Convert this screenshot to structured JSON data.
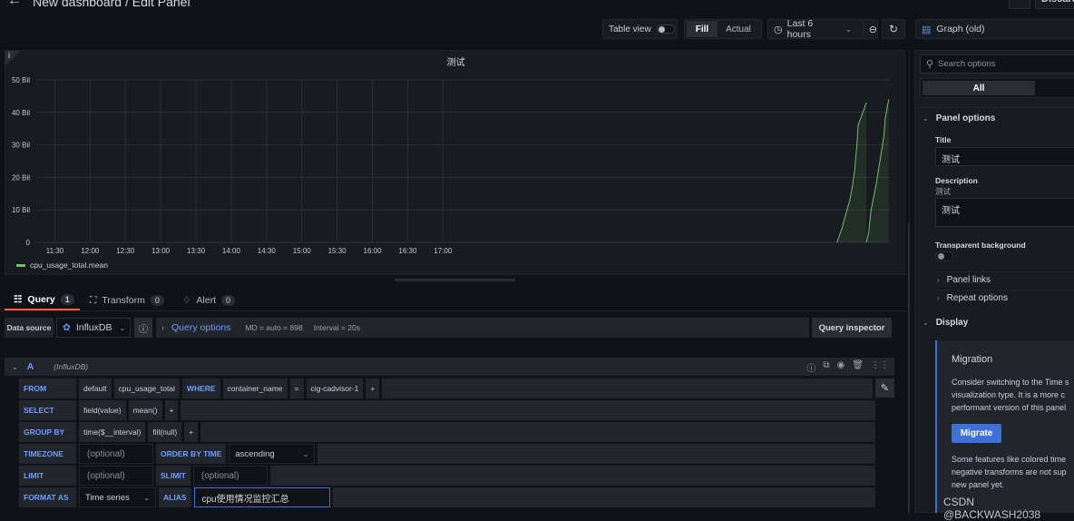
{
  "header": {
    "breadcrumb": "New dashboard / Edit Panel",
    "discard_label": "Discard"
  },
  "toolbar": {
    "table_view_label": "Table view",
    "table_view_on": false,
    "fill_label": "Fill",
    "actual_label": "Actual",
    "active_mode": "Fill",
    "time_range": "Last 6 hours",
    "visualization": "Graph (old)"
  },
  "panel": {
    "title": "测试",
    "info_icon": "i",
    "legend": "cpu_usage_total.mean"
  },
  "chart_data": {
    "type": "area",
    "title": "测试",
    "xlabel": "",
    "ylabel": "",
    "x_ticks": [
      "11:30",
      "12:00",
      "12:30",
      "13:00",
      "13:30",
      "14:00",
      "14:30",
      "15:00",
      "15:30",
      "16:00",
      "16:30",
      "17:00"
    ],
    "y_ticks": [
      "0",
      "10 Bil",
      "20 Bil",
      "30 Bil",
      "40 Bil",
      "50 Bil"
    ],
    "ylim": [
      0,
      50
    ],
    "y_unit": "Bil",
    "grid": true,
    "legend_position": "bottom-left",
    "x_range_minutes": [
      -15,
      710
    ],
    "series": [
      {
        "name": "cpu_usage_total.mean",
        "color": "#73bf69",
        "segments": [
          [
            [
              665,
              0
            ],
            [
              669,
              4
            ],
            [
              672,
              8
            ],
            [
              676,
              13
            ],
            [
              678,
              17
            ],
            [
              680,
              22
            ],
            [
              682,
              30
            ],
            [
              683,
              36
            ],
            [
              686,
              39
            ],
            [
              690,
              43
            ]
          ],
          [
            [
              690,
              0
            ],
            [
              692,
              3
            ],
            [
              694,
              10
            ],
            [
              698,
              17
            ],
            [
              702,
              26
            ],
            [
              705,
              33
            ],
            [
              706,
              38
            ],
            [
              709,
              44
            ]
          ]
        ]
      }
    ]
  },
  "query_tabs": [
    {
      "label": "Query",
      "count": "1",
      "active": true
    },
    {
      "label": "Transform",
      "count": "0",
      "active": false
    },
    {
      "label": "Alert",
      "count": "0",
      "active": false
    }
  ],
  "datasource": {
    "label": "Data source",
    "value": "InfluxDB",
    "query_options_label": "Query options",
    "md": "MD = auto = 898",
    "interval": "Interval = 20s",
    "inspector_label": "Query inspector"
  },
  "query": {
    "ref": "A",
    "datasource": "(InfluxDB)",
    "from": {
      "kw": "FROM",
      "policy": "default",
      "measurement": "cpu_usage_total",
      "where_kw": "WHERE",
      "tag": "container_name",
      "op": "=",
      "value": "cig-cadvisor-1",
      "plus": "+"
    },
    "select": {
      "kw": "SELECT",
      "field": "field(value)",
      "fn": "mean()",
      "plus": "+"
    },
    "group_by": {
      "kw": "GROUP BY",
      "time": "time($__interval)",
      "fill": "fill(null)",
      "plus": "+"
    },
    "timezone": {
      "kw": "TIMEZONE",
      "placeholder": "(optional)",
      "order_kw": "ORDER BY TIME",
      "order_value": "ascending"
    },
    "limit": {
      "kw": "LIMIT",
      "placeholder": "(optional)",
      "slimit_kw": "SLIMIT",
      "slimit_placeholder": "(optional)"
    },
    "format": {
      "kw": "FORMAT AS",
      "value": "Time series",
      "alias_kw": "ALIAS",
      "alias_value": "cpu使用情况监控汇总"
    }
  },
  "sidebar": {
    "search_placeholder": "Search options",
    "filter_all": "All",
    "panel_options": "Panel options",
    "title_label": "Title",
    "title_value": "测试",
    "description_label": "Description",
    "description_hint": "测试",
    "description_value": "测试",
    "transparent_label": "Transparent background",
    "transparent_on": false,
    "panel_links": "Panel links",
    "repeat_options": "Repeat options",
    "display": "Display",
    "migration_title": "Migration",
    "migration_text1": [
      "Consider switching to the Time s",
      "visualization type. It is a more c",
      "performant version of this panel"
    ],
    "migrate_label": "Migrate",
    "migration_text2": [
      "Some features like colored time",
      "negative transforms are not sup",
      "new panel yet."
    ]
  },
  "watermark": "CSDN @BACKWASH2038"
}
